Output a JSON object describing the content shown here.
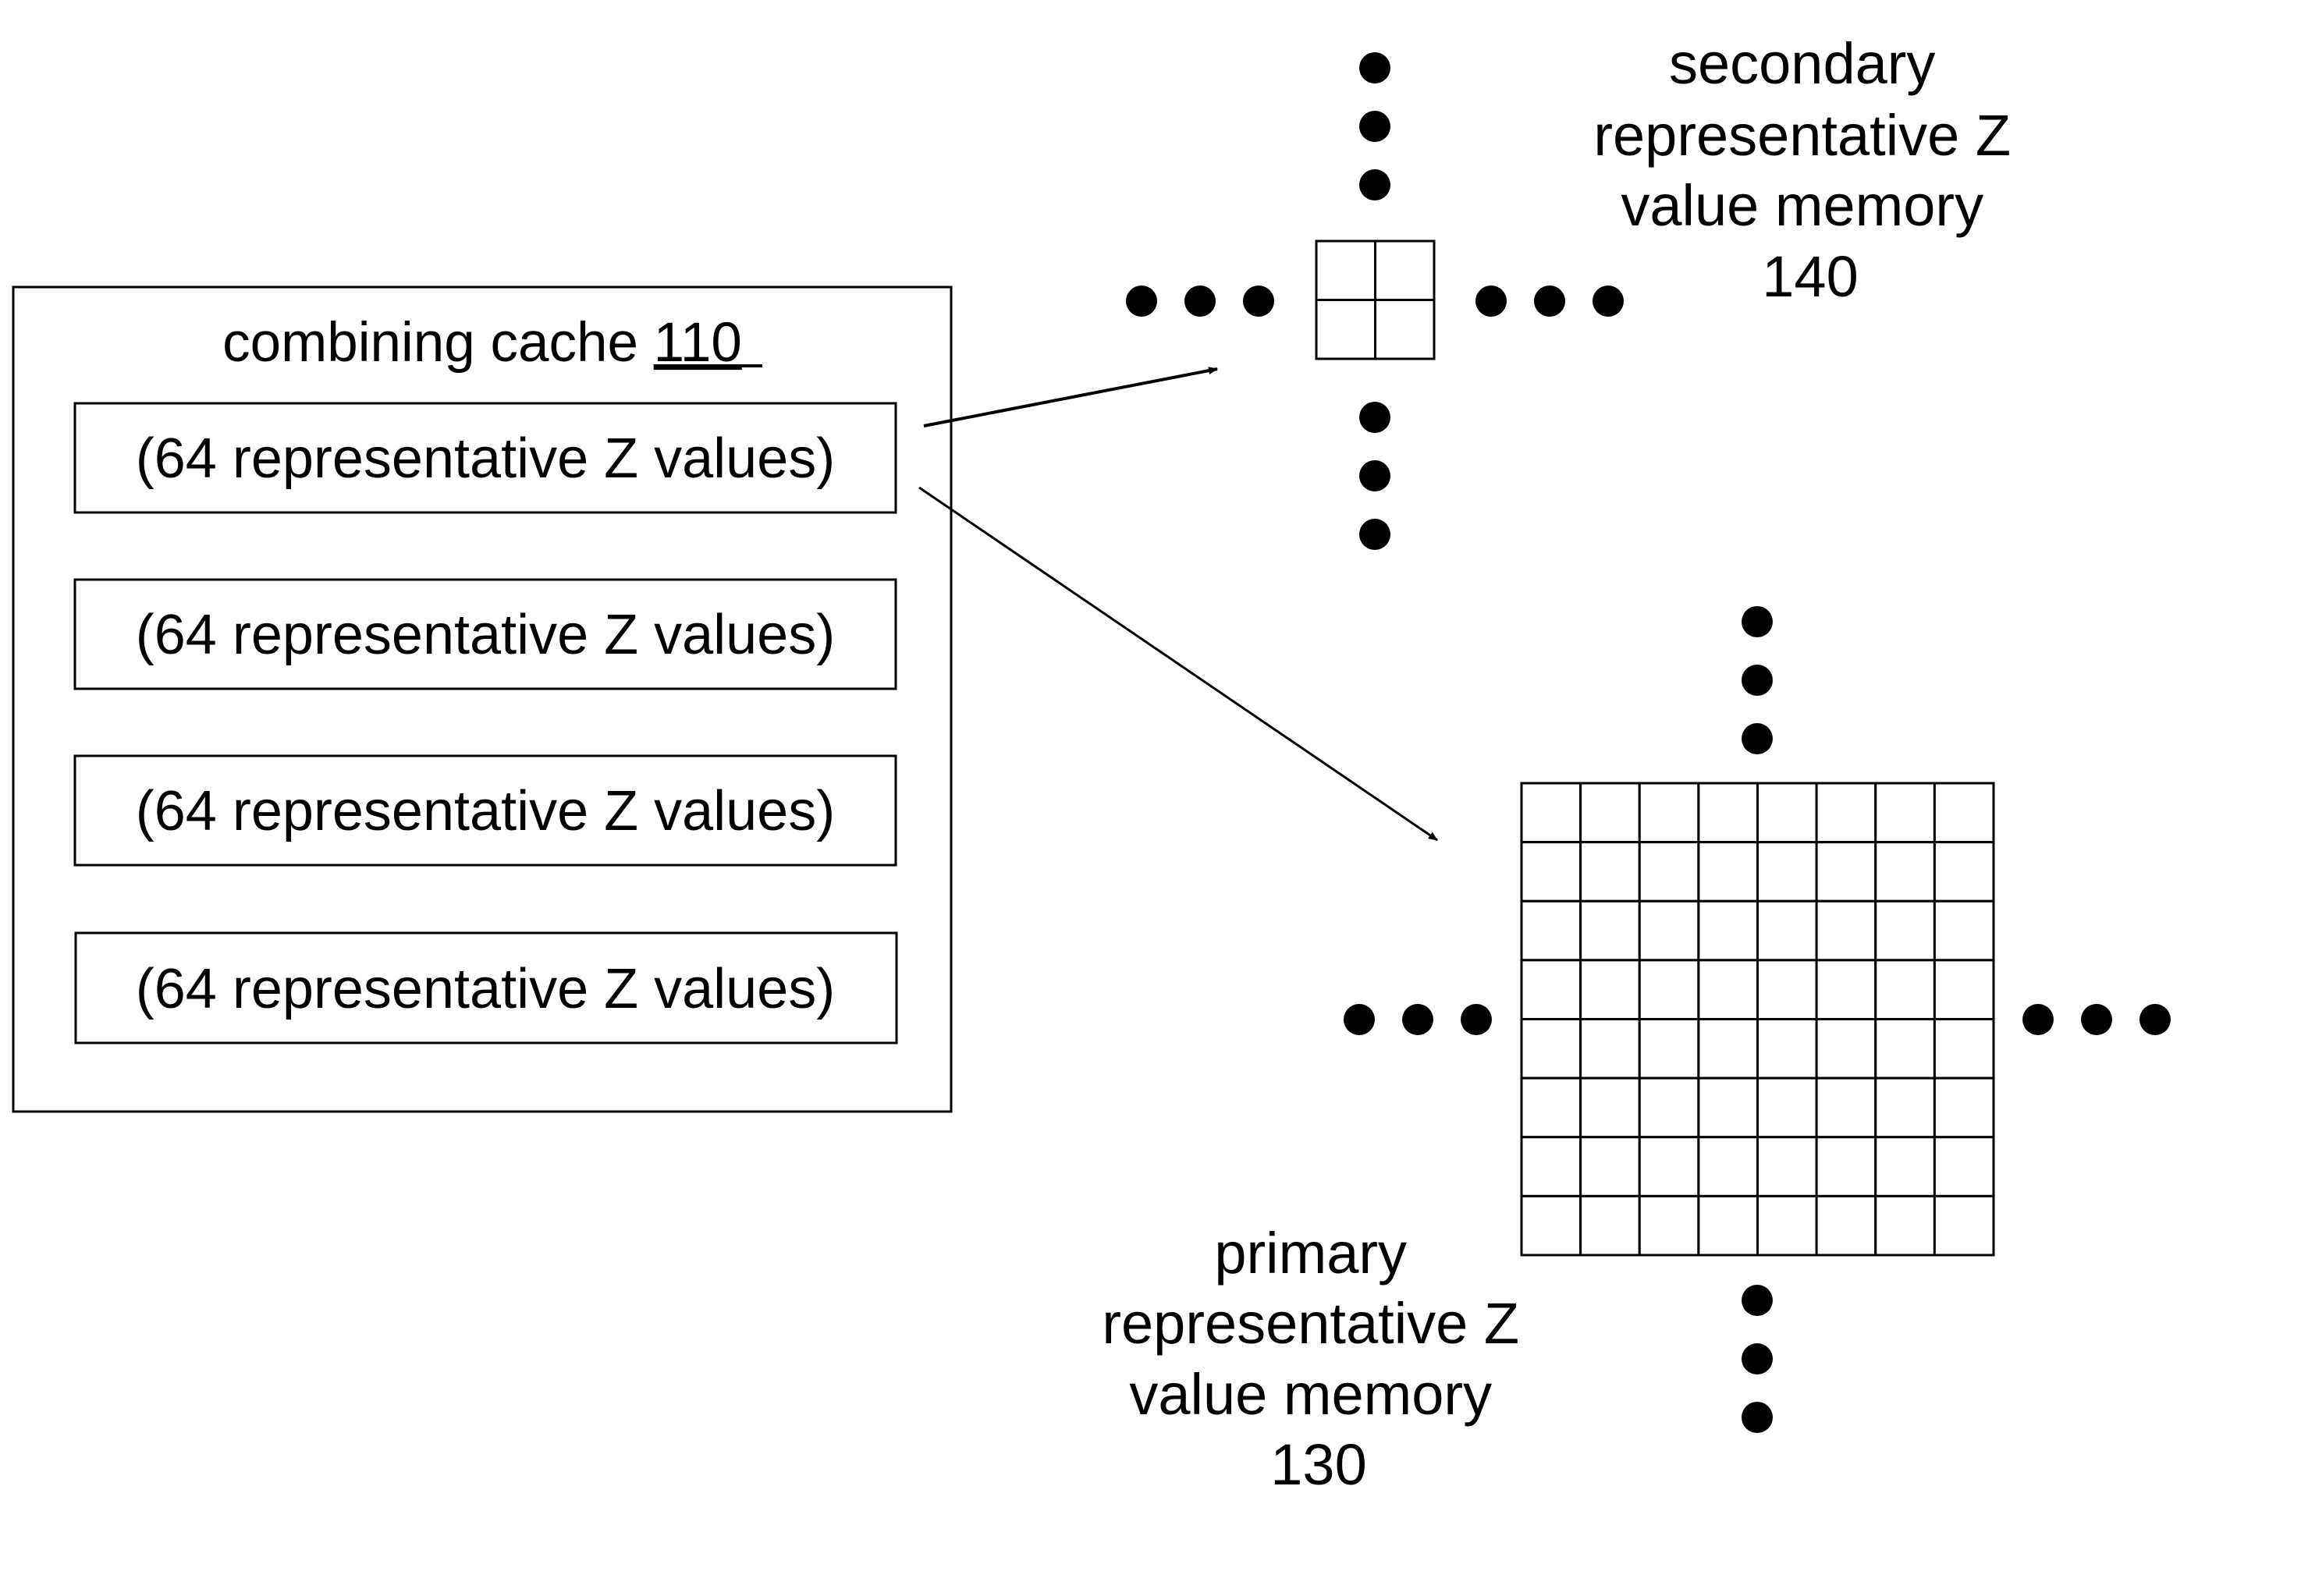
{
  "figure": {
    "stroke_color": "#000000",
    "background": "#ffffff"
  },
  "combining_cache": {
    "title": "combining cache ",
    "ref": "110",
    "entries": [
      {
        "label": "(64 representative Z values)"
      },
      {
        "label": "(64 representative Z values)"
      },
      {
        "label": "(64 representative Z values)"
      },
      {
        "label": "(64 representative Z values)"
      }
    ]
  },
  "secondary_memory": {
    "label_lines": [
      "secondary",
      "representative Z",
      "value memory",
      "140"
    ],
    "grid_rows": 2,
    "grid_cols": 2,
    "continuation_dots_per_side": 3
  },
  "primary_memory": {
    "label_lines": [
      "primary",
      "representative Z",
      "value memory",
      "130"
    ],
    "grid_rows": 8,
    "grid_cols": 8,
    "continuation_dots_per_side": 3
  },
  "arrows": [
    {
      "from": "combining-cache-entry-1",
      "to": "secondary-memory"
    },
    {
      "from": "combining-cache-entry-1",
      "to": "primary-memory"
    }
  ]
}
